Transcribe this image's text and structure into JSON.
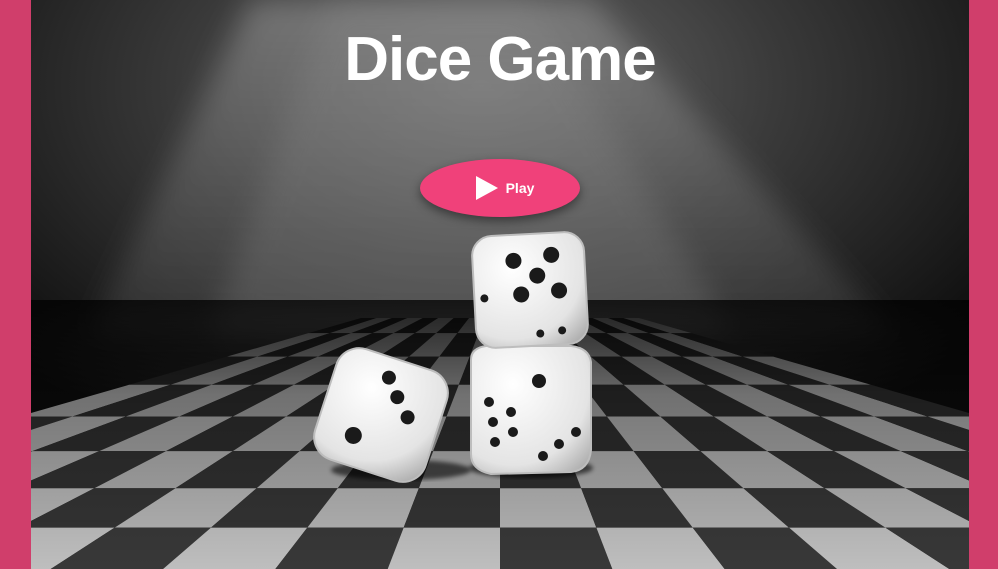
{
  "page": {
    "title": "Dice Game"
  },
  "play_button": {
    "label": "Play",
    "icon": "play-icon"
  },
  "scene": {
    "description_icon": "dice-on-chessboard",
    "dice": [
      {
        "face": 5
      },
      {
        "face": 3
      },
      {
        "face": 1
      }
    ]
  },
  "colors": {
    "frame": "#d03e6b",
    "button": "#f0417a",
    "title": "#ffffff"
  }
}
